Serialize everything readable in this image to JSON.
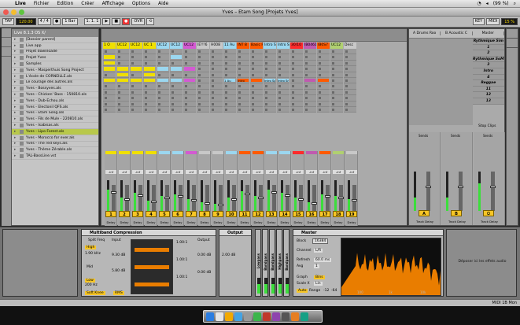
{
  "menubar": {
    "app": "Live",
    "items": [
      "Fichier",
      "Edition",
      "Créer",
      "Affichage",
      "Options",
      "Aide"
    ],
    "battery": "(99 %)"
  },
  "window": {
    "title": "Yves – Etam Song  [Projets Yves]"
  },
  "control": {
    "tap": "TAP",
    "tempo": "120.00",
    "signature": "4 / 4",
    "quant": "1 Bar",
    "ovr": "OVR",
    "key": "KEY",
    "midi": "MIDI",
    "cpu": "15 %",
    "position": "1. 1. 1"
  },
  "browser": {
    "header": "Live 8.1.3 OS X/",
    "items": [
      "[Dossier parent]",
      "Live.app",
      "Projet downloadé",
      "Projet Yves",
      "Samples",
      "Yves - Masperthuis Song Project",
      "L'école de CORNEILLE.als",
      "Le courage des autres.als",
      "Yves - Bossyves.als",
      "Yves - Chicken' Bass - 150810.als",
      "Yves - Dub-Echou.als",
      "Yves - Electonil QFS.als",
      "Yves - Etam Song.als",
      "Yves - Fils de Mule - 220810.als",
      "Yves - Isabisas.als",
      "Yves - Lipo Forest.als",
      "Yves - Morocco for ever.als",
      "Yves - The red keys.als",
      "Yves - Thème Zérable.als",
      "TAL-BassLine.vst"
    ],
    "selected_index": 15
  },
  "tracks": [
    {
      "name": "1 O",
      "color": "#f0e000"
    },
    {
      "name": "UC12",
      "color": "#f0e000"
    },
    {
      "name": "UC12",
      "color": "#f0e000"
    },
    {
      "name": "UC 1",
      "color": "#f0e000"
    },
    {
      "name": "UC12",
      "color": "#9bd7f0"
    },
    {
      "name": "UC12",
      "color": "#9bd7f0"
    },
    {
      "name": "UC12",
      "color": "#d35ad2"
    },
    {
      "name": "IE!!!6",
      "color": "#c8c8c8"
    },
    {
      "name": "H008",
      "color": "#c8c8c8"
    },
    {
      "name": "11 Au",
      "color": "#9bd7f0"
    },
    {
      "name": "INT B",
      "color": "#ff5a00"
    },
    {
      "name": "Basic Fx",
      "color": "#ff5a00"
    },
    {
      "name": "Intro Spl",
      "color": "#9bd7f0"
    },
    {
      "name": "Intro Sne",
      "color": "#9bd7f0"
    },
    {
      "name": "30/10",
      "color": "#ff2b2b"
    },
    {
      "name": "IB0461",
      "color": "#c05ab0"
    },
    {
      "name": "IB0S7",
      "color": "#ff5a00"
    },
    {
      "name": "UC12",
      "color": "#b0d070"
    },
    {
      "name": "Desc",
      "color": "#c8c8c8"
    }
  ],
  "clip_labels": [
    "Intro",
    "1 Au",
    "Intro Spl",
    "Intro Sne"
  ],
  "track_numbers": [
    "1",
    "2",
    "3",
    "4",
    "5",
    "6",
    "7",
    "8",
    "9",
    "10",
    "11",
    "12",
    "13",
    "14",
    "15",
    "16",
    "17",
    "18",
    "19"
  ],
  "returns": {
    "headers": [
      "A Drums Roo",
      "B Acoustic C",
      "Master"
    ],
    "send_letters": [
      "A",
      "B"
    ],
    "track_delay": "Track Delay",
    "sends": "Sends",
    "stop_clips": "Stop Clips",
    "scenes": [
      "Rythmique Sim",
      "1",
      "2",
      "Rythmique SoM",
      "3",
      "Intro",
      "4",
      "Reggae",
      "11",
      "12",
      "13"
    ]
  },
  "mixer": {
    "delay": "Delay",
    "db": "-inf"
  },
  "devices": {
    "multiband": {
      "title": "Multiband Compression",
      "labels": [
        "Split Freq",
        "Input",
        "High",
        "Mid",
        "Low",
        "Soft Knee",
        "RMS",
        "Output",
        "Output"
      ],
      "values": [
        "1.90 kHz",
        "9.30 dB",
        "5.80 dB",
        "200 Hz",
        "0.00 dB",
        "0.00 dB",
        "2.00 dB"
      ],
      "ratios": [
        "1.00:1",
        "1.00:1",
        "1.00:1"
      ]
    },
    "rack_labels": [
      "Lowpass",
      "Bandpass",
      "Bandpass",
      "Highpass",
      "Bandpass"
    ],
    "master": {
      "title": "Master",
      "block": "Block",
      "block_val": "16384",
      "channel": "Channel",
      "channel_val": "L/R",
      "refresh": "Refresh",
      "refresh_val": "60.0 ms",
      "avg": "Avg",
      "avg_val": "1",
      "graph": "Graph",
      "graph_val": "Bins",
      "scale": "Scale X",
      "scale_val": "Lin",
      "auto": "Auto",
      "range": "Range",
      "range_vals": [
        "-12",
        "-64"
      ],
      "freqs": [
        "100",
        "1k",
        "10k"
      ]
    },
    "drop": "Déposer ici les effets audio"
  },
  "status": {
    "left": "",
    "right": "MIDI 1B Mon"
  }
}
